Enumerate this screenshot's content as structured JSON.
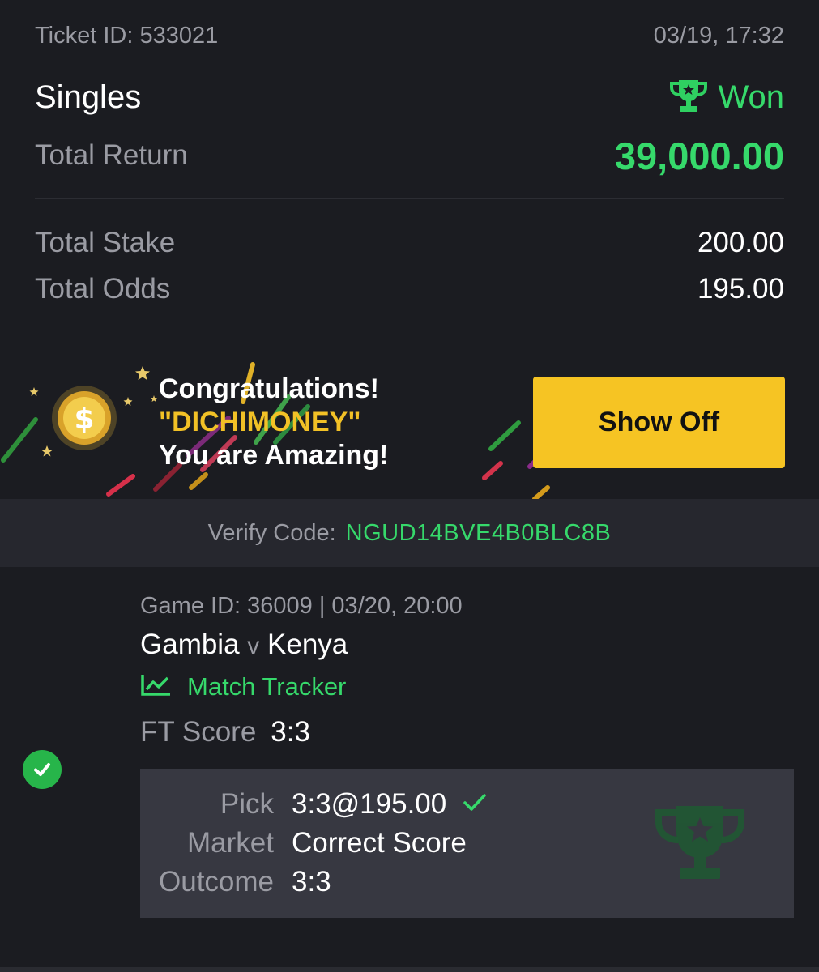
{
  "ticket": {
    "id_text": "Ticket ID: 533021",
    "datetime": "03/19, 17:32",
    "bet_type": "Singles",
    "status": "Won",
    "total_return_label": "Total Return",
    "total_return_value": "39,000.00",
    "total_stake_label": "Total Stake",
    "total_stake_value": "200.00",
    "total_odds_label": "Total Odds",
    "total_odds_value": "195.00"
  },
  "banner": {
    "line1": "Congratulations!",
    "line2": "\"DICHIMONEY\"",
    "line3": "You are Amazing!",
    "button_label": "Show Off"
  },
  "verify": {
    "label": "Verify Code:",
    "code": "NGUD14BVE4B0BLC8B"
  },
  "game": {
    "id_text": "Game ID: 36009 | 03/20, 20:00",
    "home": "Gambia",
    "vs": "v",
    "away": "Kenya",
    "tracker_label": "Match Tracker",
    "ft_label": "FT Score",
    "ft_value": "3:3",
    "pick_label": "Pick",
    "pick_value": "3:3@195.00",
    "market_label": "Market",
    "market_value": "Correct Score",
    "outcome_label": "Outcome",
    "outcome_value": "3:3"
  },
  "colors": {
    "background": "#1b1c21",
    "accent_green": "#36d96b",
    "button_yellow": "#f6c423",
    "muted_text": "#9a9ba3"
  },
  "icons": {
    "status": "trophy-icon",
    "banner": "gold-coin-icon",
    "tracker": "chart-line-icon",
    "selection": "check-circle-icon",
    "pick": "checkmark-icon",
    "watermark": "trophy-watermark-icon"
  }
}
